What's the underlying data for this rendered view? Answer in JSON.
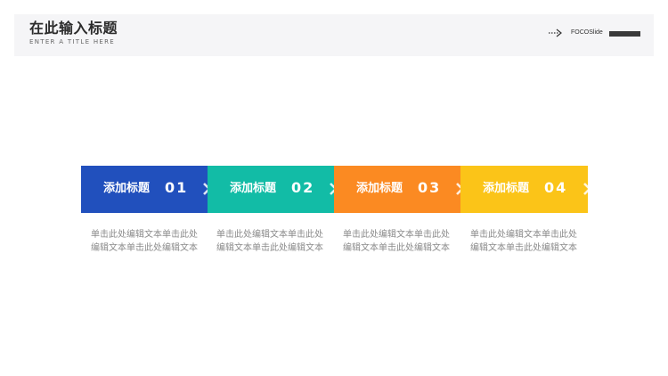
{
  "header": {
    "title": "在此输入标题",
    "subtitle": "ENTER A TITLE HERE",
    "brand": "FOCOSlide",
    "arrow_icon": "dotted-arrow-icon"
  },
  "steps": [
    {
      "label": "添加标题",
      "number": "01",
      "color": "#2150bd",
      "description": "单击此处编辑文本单击此处编辑文本单击此处编辑文本"
    },
    {
      "label": "添加标题",
      "number": "02",
      "color": "#12bca6",
      "description": "单击此处编辑文本单击此处编辑文本单击此处编辑文本"
    },
    {
      "label": "添加标题",
      "number": "03",
      "color": "#fb8a22",
      "description": "单击此处编辑文本单击此处编辑文本单击此处编辑文本"
    },
    {
      "label": "添加标题",
      "number": "04",
      "color": "#fbc418",
      "description": "单击此处编辑文本单击此处编辑文本单击此处编辑文本"
    }
  ],
  "chevron_icon": "chevron-right-icon"
}
